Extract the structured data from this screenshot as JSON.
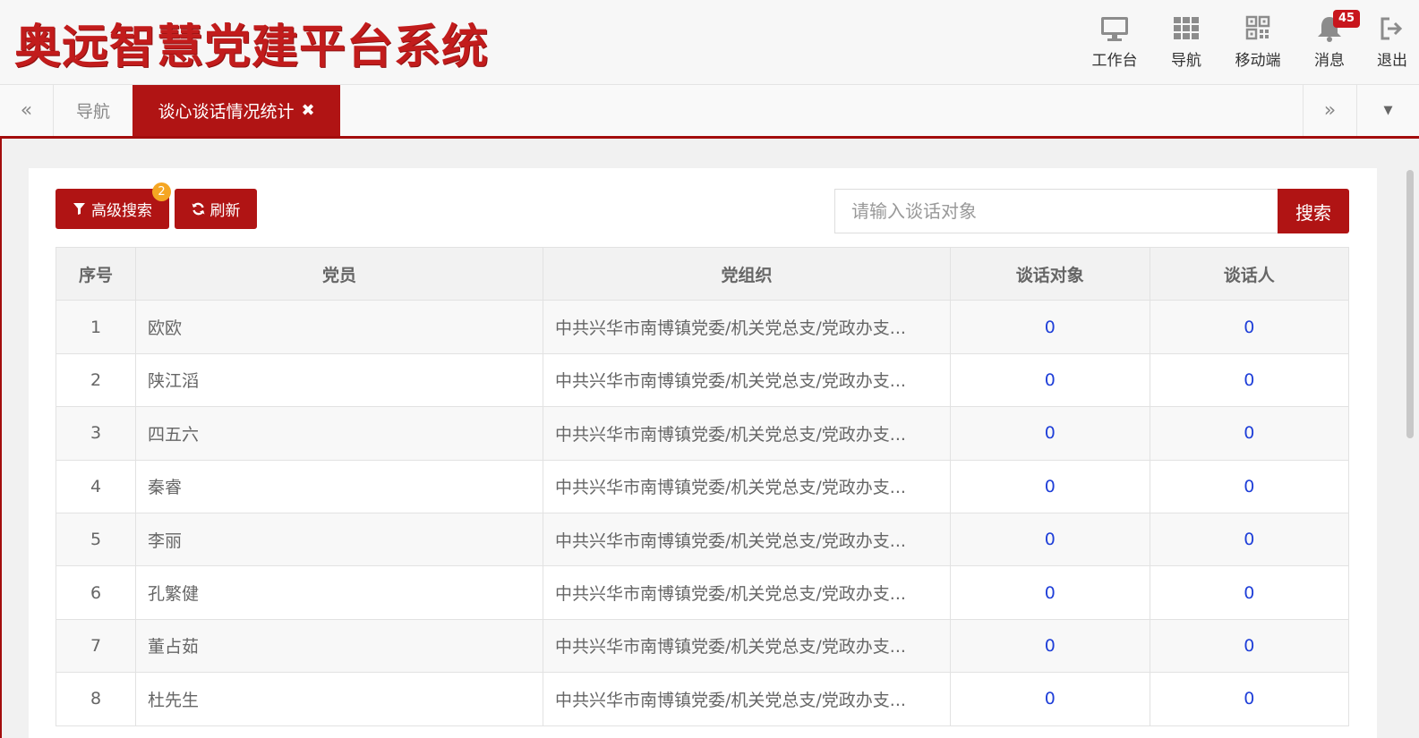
{
  "app": {
    "title": "奥远智慧党建平台系统"
  },
  "top_nav": {
    "workbench": "工作台",
    "navigation": "导航",
    "mobile": "移动端",
    "messages": "消息",
    "messages_badge": "45",
    "logout": "退出"
  },
  "tabs": {
    "prev": "«",
    "home": "导航",
    "active": "谈心谈话情况统计",
    "close": "✖",
    "next": "»",
    "menu": "▼"
  },
  "toolbar": {
    "advanced_search": "高级搜索",
    "advanced_badge": "2",
    "refresh": "刷新",
    "search_placeholder": "请输入谈话对象",
    "search_button": "搜索"
  },
  "table": {
    "headers": [
      "序号",
      "党员",
      "党组织",
      "谈话对象",
      "谈话人"
    ],
    "rows": [
      {
        "idx": "1",
        "member": "欧欧",
        "org": "中共兴华市南博镇党委/机关党总支/党政办支...",
        "target": "0",
        "speaker": "0"
      },
      {
        "idx": "2",
        "member": "陕江滔",
        "org": "中共兴华市南博镇党委/机关党总支/党政办支...",
        "target": "0",
        "speaker": "0"
      },
      {
        "idx": "3",
        "member": "四五六",
        "org": "中共兴华市南博镇党委/机关党总支/党政办支...",
        "target": "0",
        "speaker": "0"
      },
      {
        "idx": "4",
        "member": "秦睿",
        "org": "中共兴华市南博镇党委/机关党总支/党政办支...",
        "target": "0",
        "speaker": "0"
      },
      {
        "idx": "5",
        "member": "李丽",
        "org": "中共兴华市南博镇党委/机关党总支/党政办支...",
        "target": "0",
        "speaker": "0"
      },
      {
        "idx": "6",
        "member": "孔繁健",
        "org": "中共兴华市南博镇党委/机关党总支/党政办支...",
        "target": "0",
        "speaker": "0"
      },
      {
        "idx": "7",
        "member": "董占茹",
        "org": "中共兴华市南博镇党委/机关党总支/党政办支...",
        "target": "0",
        "speaker": "0"
      },
      {
        "idx": "8",
        "member": "杜先生",
        "org": "中共兴华市南博镇党委/机关党总支/党政办支...",
        "target": "0",
        "speaker": "0"
      }
    ]
  },
  "colors": {
    "brand": "#b01414",
    "link": "#1f3fd8",
    "badge": "#f5a623"
  }
}
